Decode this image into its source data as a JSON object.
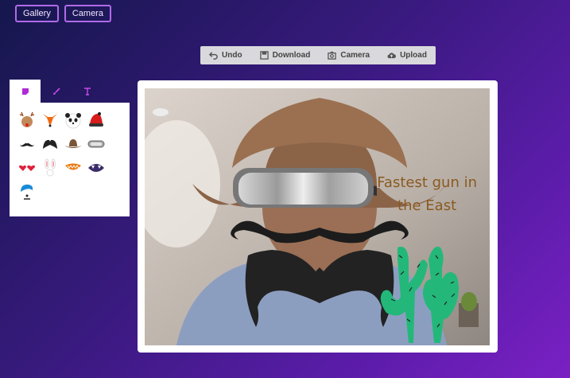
{
  "nav": {
    "gallery": "Gallery",
    "camera": "Camera"
  },
  "toolbar": {
    "undo": "Undo",
    "download": "Download",
    "camera": "Camera",
    "upload": "Upload"
  },
  "panel": {
    "tabs": [
      {
        "name": "stickers",
        "icon": "sticker-icon",
        "active": true
      },
      {
        "name": "draw",
        "icon": "brush-icon"
      },
      {
        "name": "text",
        "icon": "text-icon"
      }
    ],
    "stickers": [
      "reindeer",
      "fox",
      "panda",
      "santa-hat",
      "mustache-curly",
      "mustache-big",
      "cowboy-hat",
      "goggles",
      "heart-glasses",
      "bunny",
      "mouth-teeth",
      "monster-mouth",
      "blue-hair"
    ]
  },
  "canvas": {
    "caption_line1": "Fastest gun in",
    "caption_line2": "the East"
  },
  "colors": {
    "accent": "#b06be8",
    "caption": "#8a5a20",
    "cactus": "#23b87a"
  }
}
